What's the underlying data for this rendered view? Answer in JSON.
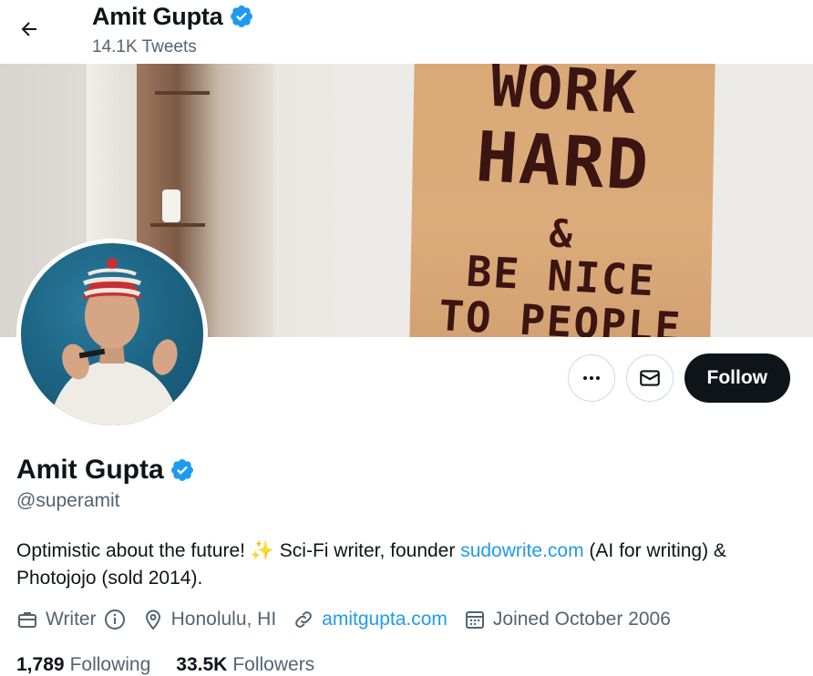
{
  "header": {
    "name": "Amit Gupta",
    "tweets_count": "14.1K Tweets"
  },
  "banner": {
    "poster_lines": [
      "WORK",
      "HARD",
      "&",
      "BE NICE",
      "TO PEOPLE"
    ]
  },
  "actions": {
    "follow_label": "Follow"
  },
  "profile": {
    "name": "Amit Gupta",
    "handle": "@superamit",
    "bio_prefix": "Optimistic about the future! ",
    "bio_emoji": "✨",
    "bio_middle": " Sci-Fi writer, founder ",
    "bio_link": "sudowrite.com",
    "bio_suffix": " (AI for writing) & Photojojo (sold 2014).",
    "profession": "Writer",
    "location": "Honolulu, HI",
    "website": "amitgupta.com",
    "joined": "Joined October 2006"
  },
  "stats": {
    "following_count": "1,789",
    "following_label": "Following",
    "followers_count": "33.5K",
    "followers_label": "Followers"
  },
  "colors": {
    "accent": "#1d9bf0",
    "text": "#0f1419",
    "secondary": "#536471"
  }
}
